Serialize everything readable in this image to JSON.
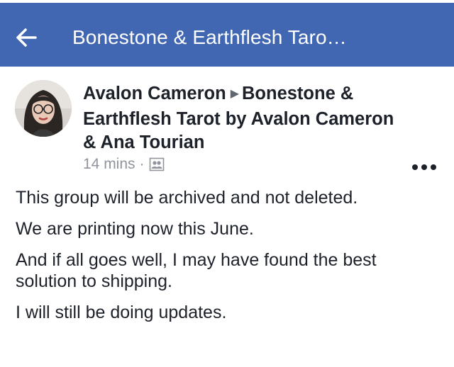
{
  "navbar": {
    "title": "Bonestone & Earthflesh Taro…",
    "background": "#4267b2",
    "back_icon": "arrow-left-icon"
  },
  "post": {
    "author": "Avalon Cameron",
    "group": "Bonestone & Earthflesh Tarot by Avalon Cameron & Ana Tourian",
    "timestamp": "14 mins",
    "separator": "·",
    "audience_icon": "group-members-icon",
    "menu_icon": "more-horizontal-icon",
    "paragraphs": [
      "This group will be archived and not deleted.",
      "We are printing now this June.",
      "And if all goes well, I may have found the best solution to shipping.",
      "I will still be doing updates."
    ]
  }
}
